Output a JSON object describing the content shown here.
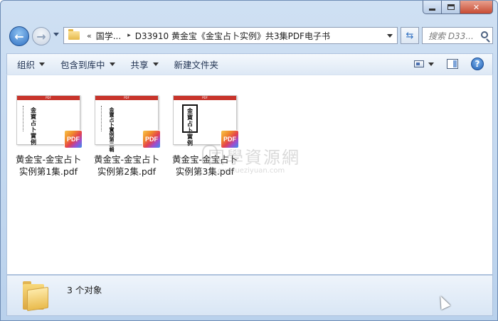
{
  "window": {
    "caption": {
      "minimize": "",
      "maximize": "",
      "close": "✕"
    }
  },
  "nav": {
    "back": "←",
    "forward": "→",
    "breadcrumb_chevron": "«",
    "crumbs": [
      "国学...",
      "D33910 黄金宝《金宝占卜实例》共3集PDF电子书"
    ],
    "crumb_arrow": "▸",
    "search_placeholder": "搜索 D33...",
    "refresh": "⇆"
  },
  "toolbar": {
    "organize": "组织",
    "include_library": "包含到库中",
    "share": "共享",
    "new_folder": "新建文件夹",
    "help": "?"
  },
  "files": [
    {
      "thumb_header": "PDF",
      "page_text": "金寶占卜實例",
      "badge": "PDF",
      "name_line1": "黄金宝-金宝占卜",
      "name_line2": "实例第1集.pdf"
    },
    {
      "thumb_header": "PDF",
      "page_text": "金寶占卜實例第二輯",
      "badge": "PDF",
      "name_line1": "黄金宝-金宝占卜",
      "name_line2": "实例第2集.pdf"
    },
    {
      "thumb_header": "PDF",
      "page_text": "金寶占卜實例",
      "badge": "PDF",
      "name_line1": "黄金宝-金宝占卜",
      "name_line2": "实例第3集.pdf"
    }
  ],
  "watermark": {
    "main": "国學資源網",
    "sub": "guoxueziyuan.com"
  },
  "details": {
    "count": "3 个对象"
  }
}
